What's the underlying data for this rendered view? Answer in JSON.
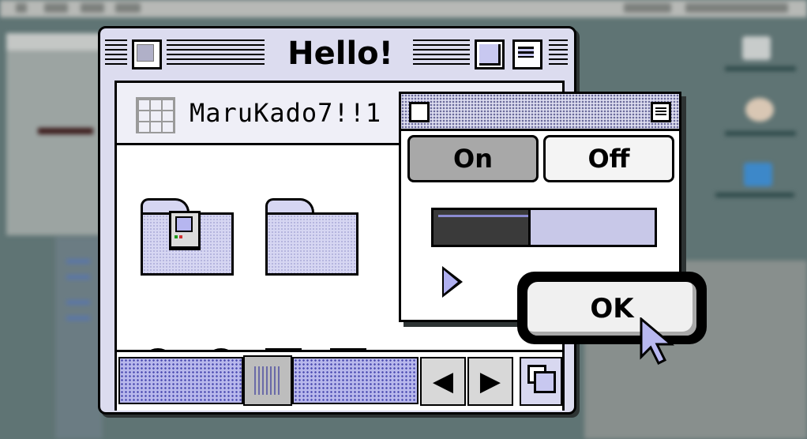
{
  "window": {
    "title": "Hello!",
    "folder_name": "MaruKado7!!1"
  },
  "palette": {
    "segmented": [
      {
        "label": "On",
        "selected": true
      },
      {
        "label": "Off",
        "selected": false
      }
    ],
    "progress": 0.43
  },
  "dialog": {
    "ok_label": "OK"
  },
  "controls": {
    "radios": [
      {
        "selected": false
      },
      {
        "selected": true
      }
    ],
    "checkboxes": [
      {
        "checked": true
      },
      {
        "checked": false
      }
    ]
  },
  "colors": {
    "window_bg": "#dcdcef",
    "accent": "#b0b0f0",
    "desktop": "#5f7474"
  },
  "icons": [
    "close-box",
    "zoom-box",
    "collapse-box",
    "grid-view",
    "folder",
    "macintosh",
    "left-arrow",
    "right-arrow",
    "grow-box",
    "disclosure-triangle",
    "mouse-pointer"
  ]
}
